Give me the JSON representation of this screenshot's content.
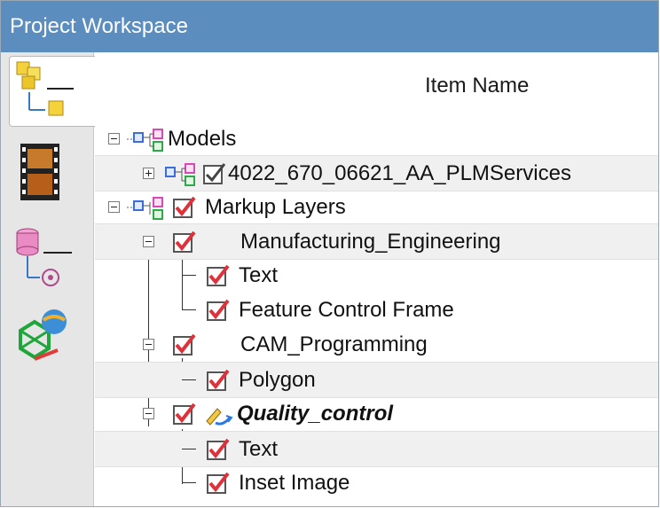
{
  "panel": {
    "title": "Project Workspace"
  },
  "sidebar": {
    "tabs": [
      {
        "icon": "hierarchy-cubes-icon",
        "active": true
      },
      {
        "icon": "film-strip-icon",
        "active": false
      },
      {
        "icon": "database-tree-icon",
        "active": false
      },
      {
        "icon": "globe-wireframe-icon",
        "active": false
      }
    ]
  },
  "tree": {
    "column_header": "Item Name",
    "rows": [
      {
        "label": "Models",
        "icon": "model-structure-icon"
      },
      {
        "label": "4022_670_06621_AA_PLMServices",
        "icon": "checkbox-checked-icon"
      },
      {
        "label": "Markup Layers",
        "icon": "checkbox-checked-icon"
      },
      {
        "label": "Manufacturing_Engineering",
        "icon": "checkbox-checked-icon"
      },
      {
        "label": "Text",
        "icon": "checkbox-checked-icon"
      },
      {
        "label": "Feature Control Frame",
        "icon": "checkbox-checked-icon"
      },
      {
        "label": "CAM_Programming",
        "icon": "checkbox-checked-icon"
      },
      {
        "label": "Polygon",
        "icon": "checkbox-checked-icon"
      },
      {
        "label": "Quality_control",
        "icon": "edit-markup-icon"
      },
      {
        "label": "Text",
        "icon": "checkbox-checked-icon"
      },
      {
        "label": "Inset Image",
        "icon": "checkbox-checked-icon"
      }
    ]
  },
  "colors": {
    "titlebar": "#5b8dbf",
    "checkmark": "#e0303a",
    "alt_row": "#f0f0f0"
  }
}
